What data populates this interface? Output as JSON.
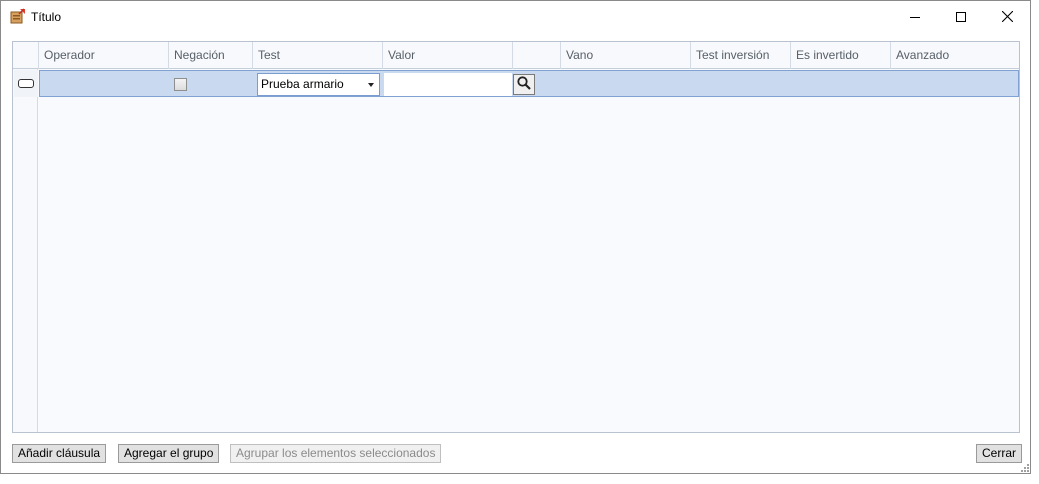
{
  "window": {
    "title": "Título"
  },
  "grid": {
    "columns": [
      "Operador",
      "Negación",
      "Test",
      "Valor",
      "",
      "Vano",
      "Test inversión",
      "Es invertido",
      "Avanzado"
    ],
    "row": {
      "negacion_checked": false,
      "test_value": "Prueba armario",
      "valor_value": ""
    }
  },
  "buttons": {
    "add_clause": "Añadir cláusula",
    "add_group": "Agregar el grupo",
    "group_selected": "Agrupar los elementos seleccionados",
    "close": "Cerrar"
  },
  "icons": [
    "app-icon",
    "minimize-icon",
    "maximize-icon",
    "close-icon",
    "row-indicator-icon",
    "search-icon",
    "resize-grip-icon"
  ],
  "colors": {
    "selected_row": "#c9daf0",
    "selected_row_border": "#7fa2d3",
    "header_text": "#575f68"
  }
}
